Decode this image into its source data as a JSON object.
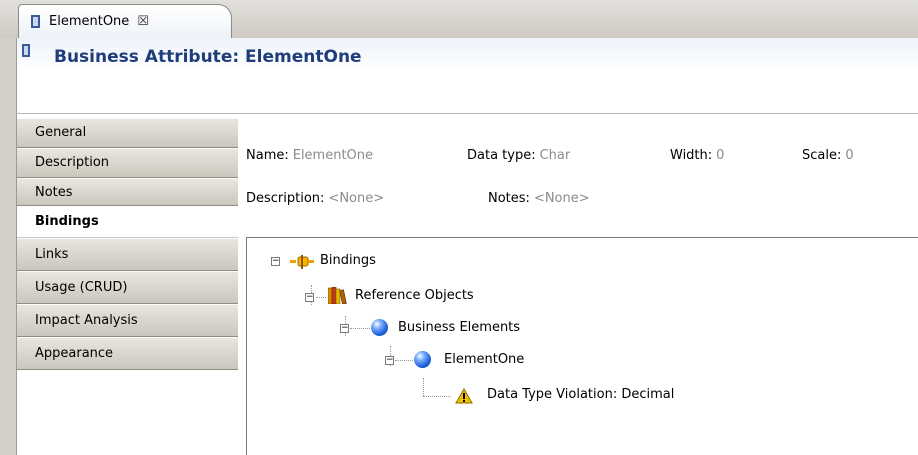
{
  "tab": {
    "label": "ElementOne",
    "close_glyph": "☒"
  },
  "header": {
    "title": "Business Attribute: ElementOne"
  },
  "nav": {
    "items": [
      {
        "label": "General",
        "active": false
      },
      {
        "label": "Description",
        "active": false
      },
      {
        "label": "Notes",
        "active": false
      },
      {
        "label": "Bindings",
        "active": true
      },
      {
        "label": "Links",
        "active": false
      },
      {
        "label": "Usage (CRUD)",
        "active": false
      },
      {
        "label": "Impact Analysis",
        "active": false
      },
      {
        "label": "Appearance",
        "active": false
      }
    ]
  },
  "fields": {
    "name": {
      "label": "Name:",
      "value": "ElementOne"
    },
    "data_type": {
      "label": "Data type:",
      "value": "Char"
    },
    "width": {
      "label": "Width:",
      "value": "0"
    },
    "scale": {
      "label": "Scale:",
      "value": "0"
    },
    "description": {
      "label": "Description:",
      "value": "<None>"
    },
    "notes": {
      "label": "Notes:",
      "value": "<None>"
    }
  },
  "tree": {
    "bindings": "Bindings",
    "reference_objects": "Reference Objects",
    "business_elements": "Business Elements",
    "element_one": "ElementOne",
    "violation": "Data Type Violation: Decimal",
    "expander_glyph": "−"
  },
  "icons": {
    "tab_icon": "attribute-icon",
    "bindings_icon": "binding-icon",
    "reference_icon": "books-icon",
    "element_icon": "sphere-icon",
    "violation_icon": "warning-icon"
  },
  "colors": {
    "title": "#1f3d7a",
    "value_gray": "#8b8b8b",
    "sphere": "#1d5fd6",
    "warning": "#f2c200"
  }
}
